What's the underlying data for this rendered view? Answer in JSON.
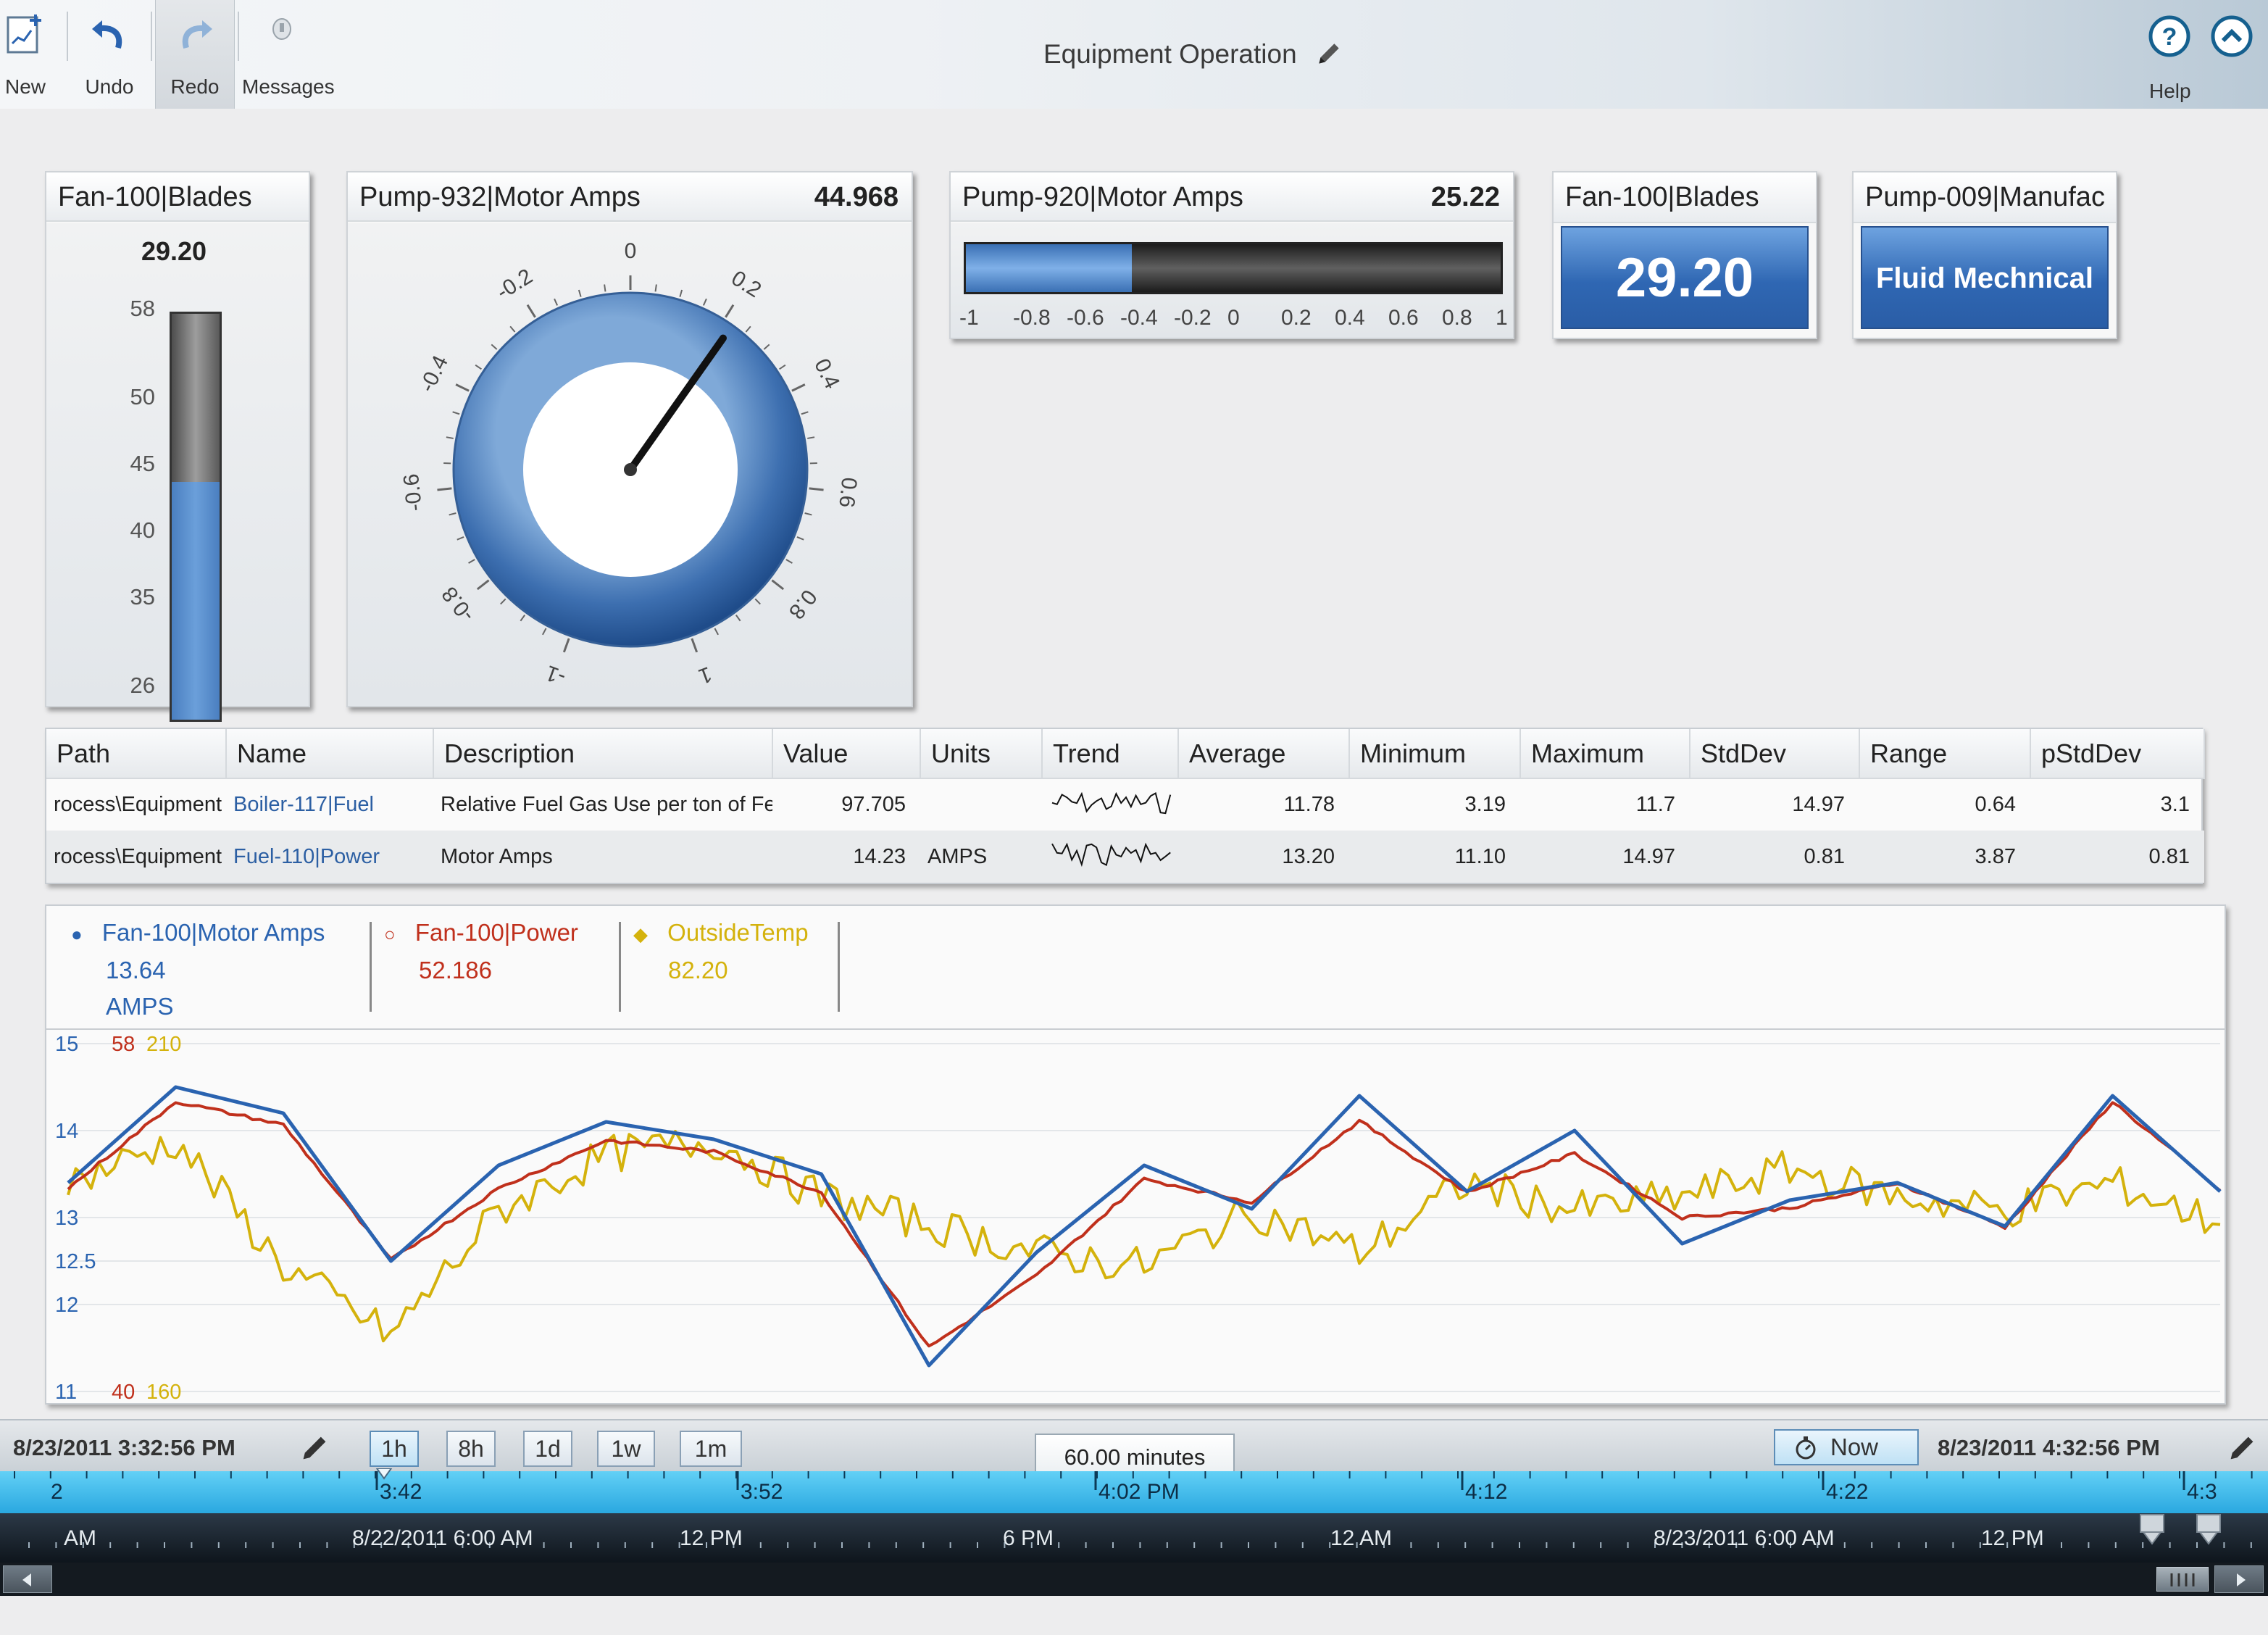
{
  "toolbar": {
    "new_label": "New",
    "undo_label": "Undo",
    "redo_label": "Redo",
    "messages_label": "Messages",
    "help_label": "Help",
    "title": "Equipment Operation"
  },
  "cards": {
    "fan_bar": {
      "title": "Fan-100|Blades",
      "value": "29.20",
      "ticks": [
        "58",
        "50",
        "45",
        "40",
        "35",
        "26"
      ],
      "level_fraction": 0.585
    },
    "pump932": {
      "title": "Pump-932|Motor Amps",
      "value": "44.968",
      "dial_labels": [
        "0",
        "0.2",
        "0.4",
        "0.6",
        "0.8",
        "1",
        "-1",
        "-0.8",
        "-0.6",
        "-0.4",
        "-0.2"
      ],
      "needle_value": 0.22
    },
    "pump920": {
      "title": "Pump-920|Motor Amps",
      "value": "25.22",
      "ticks": [
        "-1",
        "-0.8",
        "-0.6",
        "-0.4",
        "-0.2",
        "0",
        "0.2",
        "0.4",
        "0.6",
        "0.8",
        "1"
      ],
      "fill_value": -0.38
    },
    "fan_value": {
      "title": "Fan-100|Blades",
      "value": "29.20"
    },
    "pump009": {
      "title": "Pump-009|Manufac",
      "value": "Fluid Mechnical"
    }
  },
  "table": {
    "headers": [
      "Path",
      "Name",
      "Description",
      "Value",
      "Units",
      "Trend",
      "Average",
      "Minimum",
      "Maximum",
      "StdDev",
      "Range",
      "pStdDev"
    ],
    "rows": [
      [
        "rocess\\Equipment",
        "Boiler-117|Fuel",
        "Relative Fuel Gas Use per ton of Fee",
        "97.705",
        "",
        "",
        "11.78",
        "3.19",
        "11.7",
        "14.97",
        "0.64",
        "3.1"
      ],
      [
        "rocess\\Equipment",
        "Fuel-110|Power",
        "Motor Amps",
        "14.23",
        "AMPS",
        "",
        "13.20",
        "11.10",
        "14.97",
        "0.81",
        "3.87",
        "0.81"
      ]
    ]
  },
  "trend": {
    "legend": [
      {
        "name": "Fan-100|Motor Amps",
        "value": "13.64",
        "units": "AMPS",
        "color": "#2a63b0"
      },
      {
        "name": "Fan-100|Power",
        "value": "52.186",
        "units": "",
        "color": "#c0301c"
      },
      {
        "name": "OutsideTemp",
        "value": "82.20",
        "units": "",
        "color": "#d4b20c"
      }
    ],
    "y_left_ticks": [
      "15",
      "14",
      "13",
      "12.5",
      "12",
      "11"
    ],
    "y_top_red": "58",
    "y_top_yellow": "210",
    "y_bottom_red": "40",
    "y_bottom_yellow": "160"
  },
  "chart_data": {
    "type": "line",
    "series": [
      {
        "name": "Fan-100|Motor Amps",
        "ylim": [
          11,
          15
        ],
        "x": [
          0,
          3,
          6,
          9,
          12,
          15,
          18,
          21,
          24,
          27,
          30,
          33,
          36,
          39,
          42,
          45,
          48,
          51,
          54,
          57,
          60
        ],
        "values": [
          13.4,
          14.5,
          14.2,
          12.5,
          13.6,
          14.1,
          13.9,
          13.5,
          11.3,
          12.6,
          13.6,
          13.1,
          14.4,
          13.3,
          14.0,
          12.7,
          13.2,
          13.4,
          12.9,
          14.4,
          13.3
        ]
      },
      {
        "name": "Fan-100|Power",
        "ylim": [
          40,
          58
        ],
        "x": [
          0,
          3,
          6,
          9,
          12,
          15,
          18,
          21,
          24,
          27,
          30,
          33,
          36,
          39,
          42,
          45,
          48,
          51,
          54,
          57,
          60
        ],
        "values": [
          50.5,
          55.0,
          53.8,
          46.8,
          50.5,
          53.0,
          52.4,
          50.3,
          42.3,
          46.0,
          51.0,
          49.8,
          54.0,
          50.3,
          52.3,
          49.0,
          49.5,
          50.8,
          48.5,
          55.0,
          50.4
        ]
      },
      {
        "name": "OutsideTemp",
        "ylim": [
          160,
          210
        ],
        "x": [
          0,
          3,
          6,
          9,
          12,
          15,
          18,
          21,
          24,
          27,
          30,
          33,
          36,
          39,
          42,
          45,
          48,
          51,
          54,
          57,
          60
        ],
        "values": [
          190,
          196,
          178,
          168,
          186,
          194,
          196,
          188,
          184,
          180,
          178,
          186,
          180,
          190,
          186,
          188,
          192,
          188,
          186,
          190,
          184
        ]
      }
    ],
    "y_ticks": [
      15,
      14,
      13,
      12.5,
      12,
      11
    ]
  },
  "timebar": {
    "start": "8/23/2011 3:32:56 PM",
    "end": "8/23/2011 4:32:56 PM",
    "ranges": [
      "1h",
      "8h",
      "1d",
      "1w",
      "1m"
    ],
    "selected_range": "1h",
    "duration": "60.00 minutes",
    "now_label": "Now",
    "axis1_labels": [
      "2",
      "3:42",
      "3:52",
      "4:02 PM",
      "4:12",
      "4:22",
      "4:3"
    ],
    "axis2_labels": [
      "AM",
      "8/22/2011 6:00 AM",
      "12 PM",
      "6 PM",
      "12 AM",
      "8/23/2011 6:00 AM",
      "12 PM"
    ]
  },
  "colors": {
    "amps": "#2a63b0",
    "power": "#c0301c",
    "temp": "#d4b20c",
    "link": "#2c5fa3"
  }
}
